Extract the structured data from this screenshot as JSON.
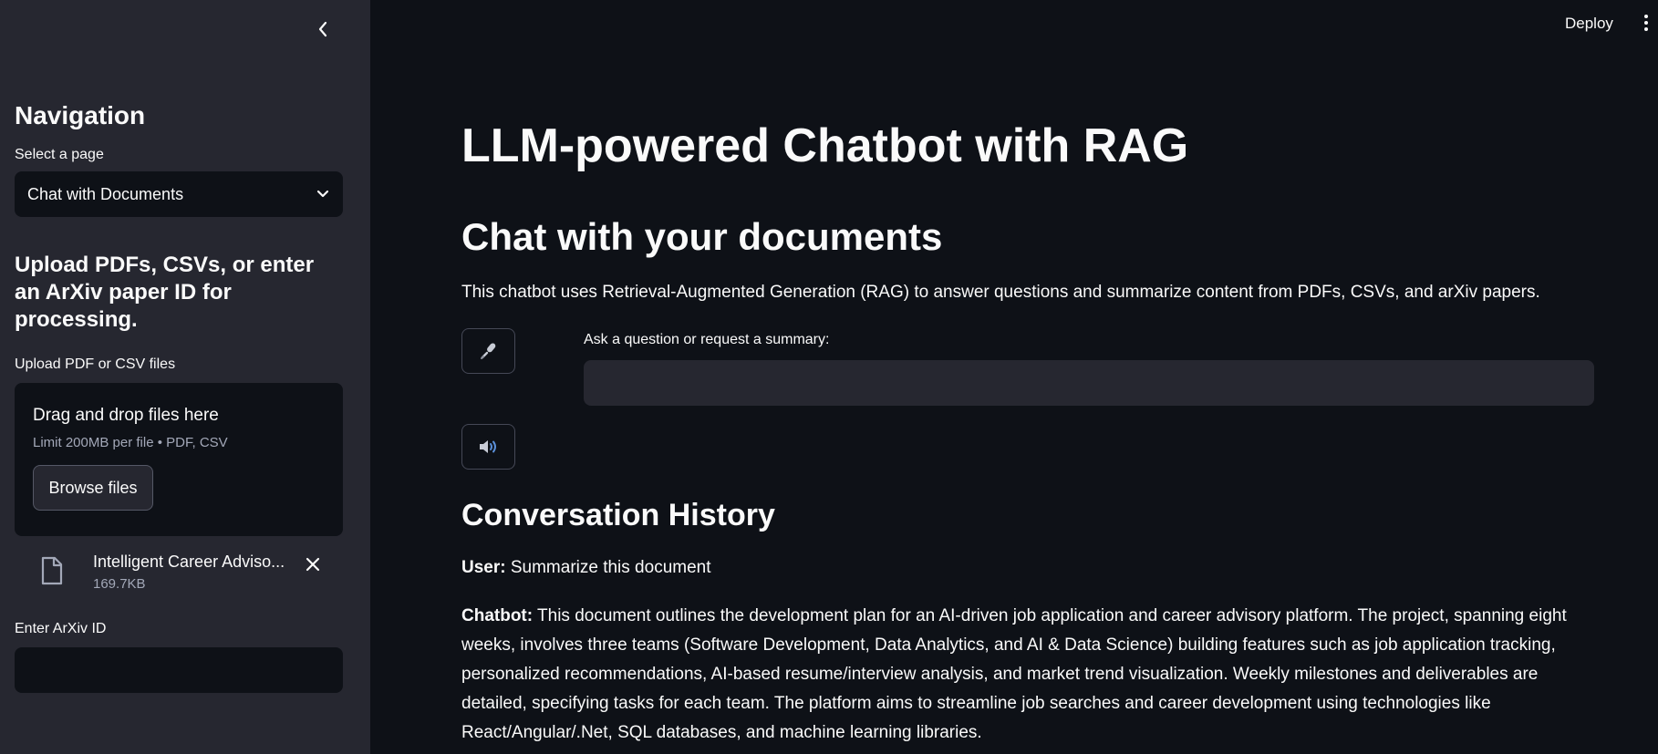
{
  "sidebar": {
    "heading": "Navigation",
    "select_label": "Select a page",
    "select_value": "Chat with Documents",
    "upload_heading": "Upload PDFs, CSVs, or enter an ArXiv paper ID for processing.",
    "upload_label": "Upload PDF or CSV files",
    "dropzone_title": "Drag and drop files here",
    "dropzone_limit": "Limit 200MB per file • PDF, CSV",
    "browse_label": "Browse files",
    "file": {
      "name": "Intelligent Career Adviso...",
      "size": "169.7KB"
    },
    "arxiv_label": "Enter ArXiv ID",
    "arxiv_value": ""
  },
  "header": {
    "deploy_label": "Deploy"
  },
  "main": {
    "title": "LLM-powered Chatbot with RAG",
    "subtitle": "Chat with your documents",
    "description": "This chatbot uses Retrieval-Augmented Generation (RAG) to answer questions and summarize content from PDFs, CSVs, and arXiv papers.",
    "ask_label": "Ask a question or request a summary:",
    "ask_value": "",
    "history_heading": "Conversation History",
    "history": [
      {
        "speaker": "User:",
        "text": "Summarize this document"
      },
      {
        "speaker": "Chatbot:",
        "text": "This document outlines the development plan for an AI-driven job application and career advisory platform. The project, spanning eight weeks, involves three teams (Software Development, Data Analytics, and AI & Data Science) building features such as job application tracking, personalized recommendations, AI-based resume/interview analysis, and market trend visualization. Weekly milestones and deliverables are detailed, specifying tasks for each team. The platform aims to streamline job searches and career development using technologies like React/Angular/.Net, SQL databases, and machine learning libraries."
      }
    ]
  },
  "icons": {
    "collapse": "chevron-left-icon",
    "select_arrow": "chevron-down-icon",
    "file": "file-icon",
    "remove": "close-icon",
    "mic": "microphone-icon",
    "speaker": "speaker-icon",
    "menu": "kebab-menu-icon"
  },
  "colors": {
    "background": "#0e1117",
    "sidebar": "#262730",
    "text": "#fafafa",
    "muted": "#a3a8b8"
  }
}
